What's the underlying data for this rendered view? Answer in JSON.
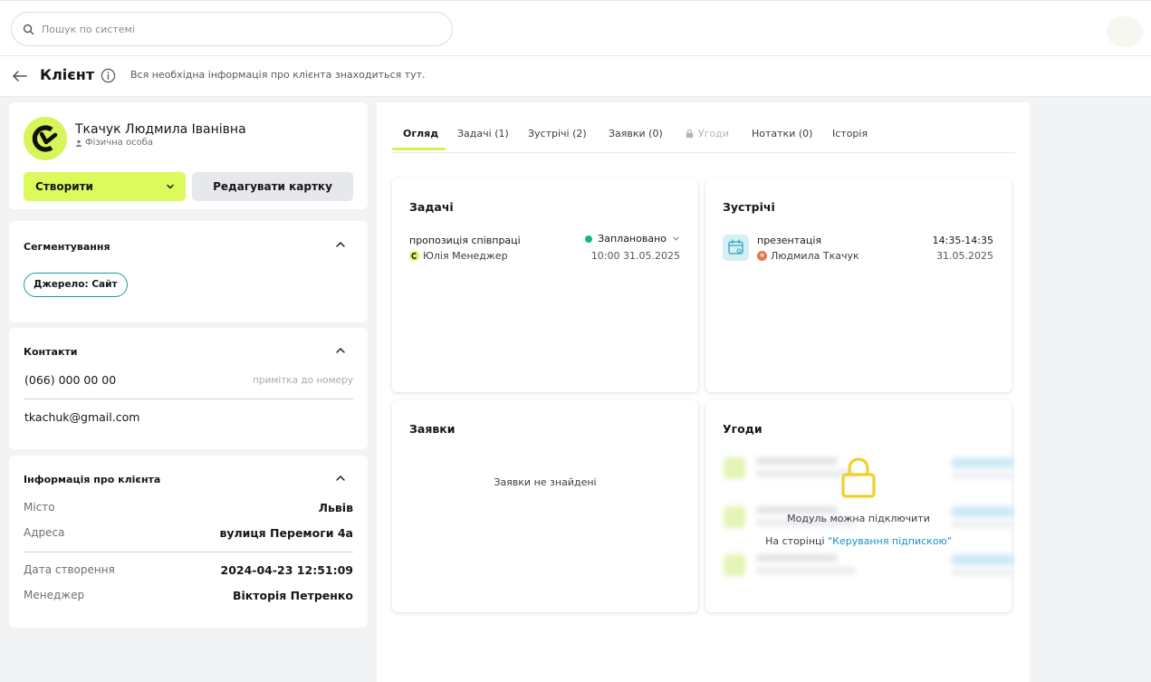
{
  "search": {
    "placeholder": "Пошук по системі"
  },
  "header": {
    "title": "Клієнт",
    "description": "Вся необхідна інформація про клієнта знаходиться тут."
  },
  "profile": {
    "name": "Ткачук Людмила Іванівна",
    "type": "Фізична особа",
    "create_label": "Створити",
    "edit_label": "Редагувати картку"
  },
  "segmentation": {
    "title": "Сегментування",
    "tags": [
      "Джерело: Сайт"
    ]
  },
  "contacts": {
    "title": "Контакти",
    "phone": "(066) 000 00 00",
    "phone_note": "примітка до номеру",
    "email": "tkachuk@gmail.com"
  },
  "client_info": {
    "title": "Інформація про клієнта",
    "city_label": "Місто",
    "city": "Львів",
    "address_label": "Адреса",
    "address": "вулиця Перемоги 4а",
    "created_label": "Дата створення",
    "created": "2024-04-23 12:51:09",
    "manager_label": "Менеджер",
    "manager": "Вікторія Петренко"
  },
  "tabs": [
    {
      "label": "Огляд"
    },
    {
      "label": "Задачі (1)"
    },
    {
      "label": "Зустрічі (2)"
    },
    {
      "label": "Заявки (0)"
    },
    {
      "label": "Угоди"
    },
    {
      "label": "Нотатки (0)"
    },
    {
      "label": "Історія"
    }
  ],
  "tasks": {
    "title": "Задачі",
    "item": {
      "title": "пропозиція співпраці",
      "owner": "Юлія Менеджер",
      "status": "Заплановано",
      "status_color": "#15b57f",
      "time": "10:00 31.05.2025"
    }
  },
  "meetings": {
    "title": "Зустрічі",
    "item": {
      "title": "презентація",
      "person": "Людмила Ткачук",
      "time": "14:35-14:35",
      "date": "31.05.2025"
    }
  },
  "requests": {
    "title": "Заявки",
    "empty": "Заявки не знайдені"
  },
  "deals": {
    "title": "Угоди",
    "locked_msg": "Модуль можна підключити",
    "locked_prefix": "На сторінці ",
    "locked_link": "\"Керування підпискою\""
  },
  "colors": {
    "accent": "#dcfa5c",
    "tag_border": "#1a9e9e",
    "link": "#1a8fc7",
    "lock": "#f2cf2a"
  }
}
